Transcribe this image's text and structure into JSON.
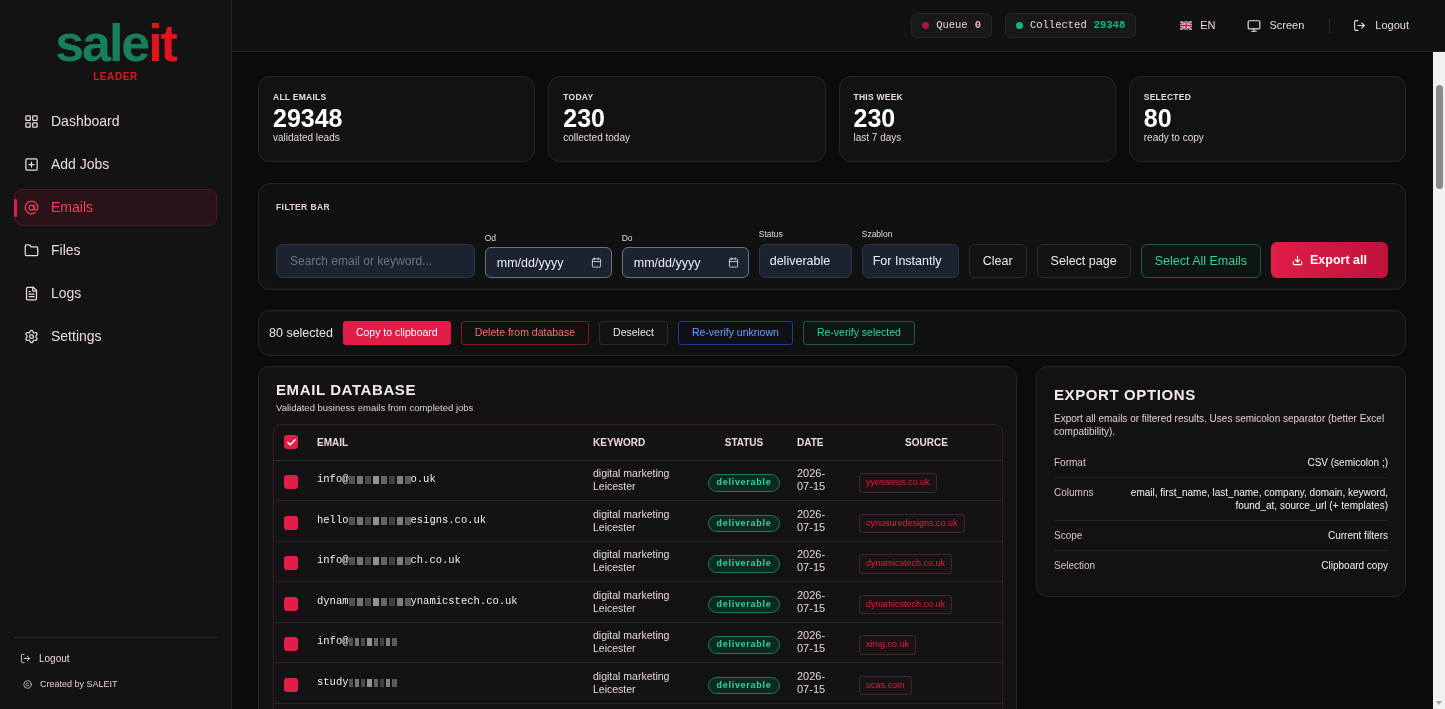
{
  "sidebar": {
    "logo": {
      "part_1": "sale",
      "part_2": "it",
      "tagline": "LEADER"
    },
    "items": [
      {
        "label": "Dashboard",
        "selected": false
      },
      {
        "label": "Add Jobs",
        "selected": false
      },
      {
        "label": "Emails",
        "selected": true
      },
      {
        "label": "Files",
        "selected": false
      },
      {
        "label": "Logs",
        "selected": false
      },
      {
        "label": "Settings",
        "selected": false
      }
    ],
    "footer": {
      "logout": "Logout",
      "credit": "Created by SALEIT"
    }
  },
  "top_bar": {
    "badges": [
      {
        "label": "Queue",
        "value": "0",
        "color": "#9f1d3a",
        "kind": "idle"
      },
      {
        "label": "Collected",
        "value": "29348",
        "color": "#10b981",
        "kind": "positive"
      }
    ],
    "language": "EN",
    "screen": "Screen",
    "logout": "Logout"
  },
  "stats": [
    {
      "label": "ALL EMAILS",
      "value": "29348",
      "caption": "validated leads"
    },
    {
      "label": "TODAY",
      "value": "230",
      "caption": "collected today"
    },
    {
      "label": "THIS WEEK",
      "value": "230",
      "caption": "last 7 days"
    },
    {
      "label": "SELECTED",
      "value": "80",
      "caption": "ready to copy"
    }
  ],
  "filter_bar": {
    "title": "FILTER BAR",
    "search": {
      "placeholder": "Search email or keyword..."
    },
    "date_from": {
      "label": "Od",
      "placeholder": "mm/dd/yyyy"
    },
    "date_to": {
      "label": "Do",
      "placeholder": "mm/dd/yyyy"
    },
    "status": {
      "label": "Status",
      "value": "deliverable"
    },
    "template": {
      "label": "Szablon",
      "value": "For Instantly"
    },
    "buttons": [
      {
        "label": "Clear",
        "kind": "neutral"
      },
      {
        "label": "Select page",
        "kind": "neutral"
      },
      {
        "label": "Select All Emails",
        "kind": "success"
      },
      {
        "label": "Export all",
        "kind": "primary"
      }
    ]
  },
  "selection_bar": {
    "count": "80 selected",
    "buttons": [
      {
        "label": "Copy to clipboard",
        "kind": "primary"
      },
      {
        "label": "Delete from database",
        "kind": "danger"
      },
      {
        "label": "Deselect",
        "kind": "neutral"
      },
      {
        "label": "Re-verify unknown",
        "kind": "info"
      },
      {
        "label": "Re-verify selected",
        "kind": "success"
      }
    ]
  },
  "email_database": {
    "title": "EMAIL DATABASE",
    "subtitle": "Validated business emails from completed jobs",
    "select_all": {
      "checked": true
    },
    "columns": [
      "EMAIL",
      "KEYWORD",
      "STATUS",
      "DATE",
      "SOURCE"
    ],
    "rows": [
      {
        "checked": true,
        "email_start": "info@",
        "email_end": "o.uk",
        "keyword": "digital marketing Leicester",
        "status": "deliverable",
        "date": "2026-07-15",
        "source": "yyesweus.co.uk"
      },
      {
        "checked": true,
        "email_start": "hello",
        "email_end": "esigns.co.uk",
        "keyword": "digital marketing Leicester",
        "status": "deliverable",
        "date": "2026-07-15",
        "source": "cynosuredesigns.co.uk"
      },
      {
        "checked": true,
        "email_start": "info@",
        "email_end": "ch.co.uk",
        "keyword": "digital marketing Leicester",
        "status": "deliverable",
        "date": "2026-07-15",
        "source": "dynamicstech.co.uk"
      },
      {
        "checked": true,
        "email_start": "dynam",
        "email_end": "ynamicstech.co.uk",
        "keyword": "digital marketing Leicester",
        "status": "deliverable",
        "date": "2026-07-15",
        "source": "dynamicstech.co.uk"
      },
      {
        "checked": true,
        "email_start": "info@",
        "keyword": "digital marketing Leicester",
        "status": "deliverable",
        "date": "2026-07-15",
        "source": "ximg.co.uk"
      },
      {
        "checked": true,
        "email_start": "study",
        "keyword": "digital marketing Leicester",
        "status": "deliverable",
        "date": "2026-07-15",
        "source": "ucas.com"
      }
    ]
  },
  "export_options": {
    "title": "EXPORT OPTIONS",
    "description": "Export all emails or filtered results. Uses semicolon separator (better Excel compatibility).",
    "rows": [
      {
        "label": "Format",
        "value": "CSV (semicolon ;)"
      },
      {
        "label": "Columns",
        "value": "email, first_name, last_name, company, domain, keyword, found_at, source_url (+ templates)"
      },
      {
        "label": "Scope",
        "value": "Current filters"
      },
      {
        "label": "Selection",
        "value": "Clipboard copy"
      }
    ]
  }
}
